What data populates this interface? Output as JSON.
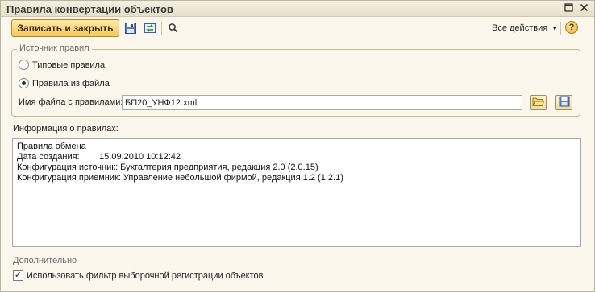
{
  "window": {
    "title": "Правила конвертации объектов"
  },
  "toolbar": {
    "save_close_label": "Записать и закрыть",
    "all_actions_label": "Все действия",
    "help_label": "?"
  },
  "source_group": {
    "legend": "Источник правил",
    "options": [
      {
        "label": "Типовые правила",
        "selected": false
      },
      {
        "label": "Правила из файла",
        "selected": true
      }
    ],
    "file_label": "Имя файла с правилами:",
    "file_value": "БП20_УНФ12.xml"
  },
  "info": {
    "label": "Информация о правилах:",
    "lines": [
      "Правила обмена",
      "Дата создания:        15.09.2010 10:12:42",
      "Конфигурация источник: Бухгалтерия предприятия, редакция 2.0 (2.0.15)",
      "Конфигурация приемник: Управление небольшой фирмой, редакция 1.2 (1.2.1)"
    ]
  },
  "extra": {
    "legend": "Дополнительно",
    "filter_checkbox_label": "Использовать фильтр выборочной регистрации объектов",
    "filter_checkbox_checked": true
  },
  "icons": {
    "save": "floppy-disk-icon",
    "refresh": "refresh-icon",
    "search": "search-icon",
    "folder": "folder-open-icon",
    "save_file": "save-file-icon",
    "help": "help-icon",
    "close": "close-icon",
    "maximize": "maximize-icon"
  }
}
